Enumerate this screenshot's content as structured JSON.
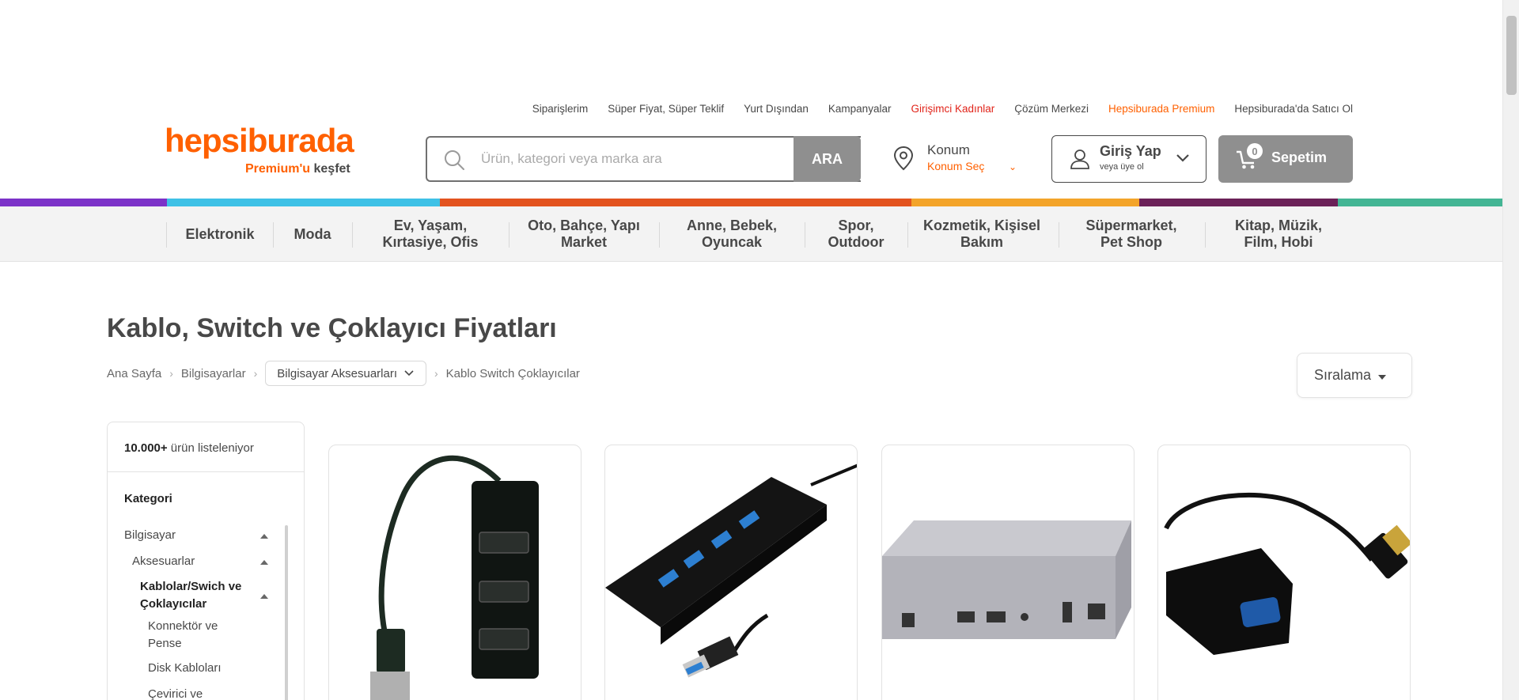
{
  "top_links": [
    {
      "label": "Siparişlerim",
      "style": "normal"
    },
    {
      "label": "Süper Fiyat, Süper Teklif",
      "style": "normal"
    },
    {
      "label": "Yurt Dışından",
      "style": "normal"
    },
    {
      "label": "Kampanyalar",
      "style": "normal"
    },
    {
      "label": "Girişimci Kadınlar",
      "style": "red"
    },
    {
      "label": "Çözüm Merkezi",
      "style": "normal"
    },
    {
      "label": "Hepsiburada Premium",
      "style": "orange"
    },
    {
      "label": "Hepsiburada'da Satıcı Ol",
      "style": "normal"
    }
  ],
  "logo": {
    "text": "hepsiburada",
    "sub_highlight": "Premium'u",
    "sub_rest": "keşfet"
  },
  "search": {
    "placeholder": "Ürün, kategori veya marka ara",
    "button": "ARA"
  },
  "location": {
    "title": "Konum",
    "subtitle": "Konum Seç"
  },
  "login": {
    "title": "Giriş Yap",
    "subtitle": "veya üye ol"
  },
  "cart": {
    "label": "Sepetim",
    "count": "0"
  },
  "colors": {
    "brand": "#ff6000",
    "stripe": [
      "#7c32c8",
      "#3ec1e6",
      "#e3531f",
      "#f3a42a",
      "#6b2158",
      "#43b594"
    ]
  },
  "categories": [
    "Elektronik",
    "Moda",
    "Ev, Yaşam, Kırtasiye, Ofis",
    "Oto, Bahçe, Yapı Market",
    "Anne, Bebek, Oyuncak",
    "Spor, Outdoor",
    "Kozmetik, Kişisel Bakım",
    "Süpermarket, Pet Shop",
    "Kitap, Müzik, Film, Hobi"
  ],
  "page_title": "Kablo, Switch ve Çoklayıcı Fiyatları",
  "breadcrumb": {
    "home": "Ana Sayfa",
    "level1": "Bilgisayarlar",
    "level2": "Bilgisayar Aksesuarları",
    "current": "Kablo Switch Çoklayıcılar"
  },
  "sort": {
    "label": "Sıralama"
  },
  "sidebar": {
    "count_bold": "10.000+",
    "count_rest": " ürün listeleniyor",
    "heading": "Kategori",
    "items": [
      {
        "label": "Bilgisayar"
      },
      {
        "label": "Aksesuarlar"
      },
      {
        "label": "Kablolar/Swich ve Çoklayıcılar"
      },
      {
        "label": "Konnektör ve Pense"
      },
      {
        "label": "Disk Kabloları"
      },
      {
        "label": "Çevirici ve"
      }
    ]
  },
  "products": [
    {
      "image": "usb-hub-vertical-black"
    },
    {
      "image": "usb3-hub-4-port-black"
    },
    {
      "image": "hdmi-kvm-ip-extender"
    },
    {
      "image": "hdmi-to-vga-adapter"
    }
  ]
}
